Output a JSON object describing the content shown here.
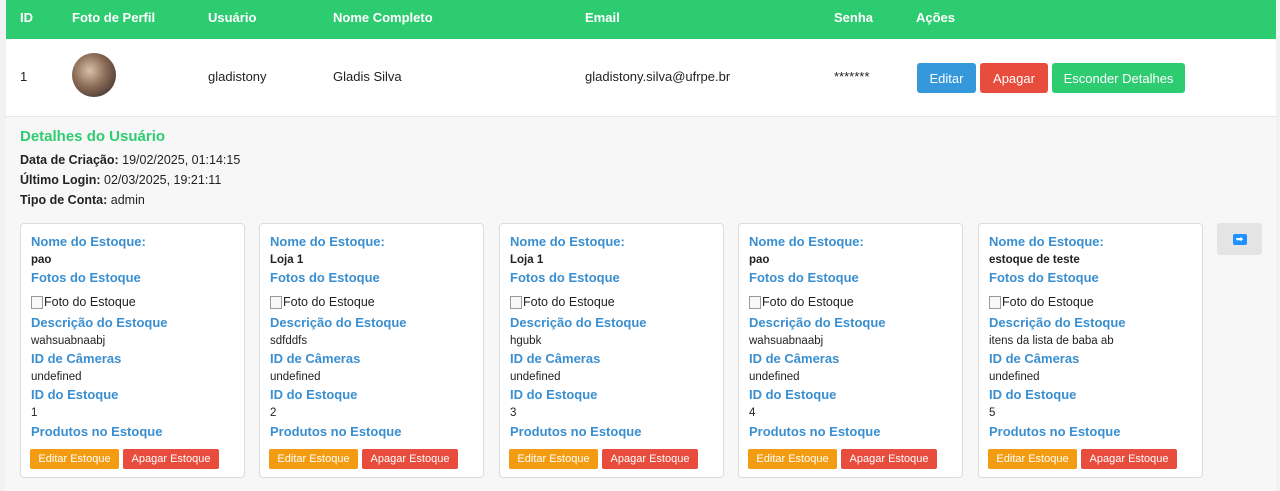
{
  "table": {
    "headers": [
      "ID",
      "Foto de Perfil",
      "Usuário",
      "Nome Completo",
      "Email",
      "Senha",
      "Ações"
    ],
    "row": {
      "id": "1",
      "username": "gladistony",
      "fullname": "Gladis Silva",
      "email": "gladistony.silva@ufrpe.br",
      "password": "*******",
      "edit_label": "Editar",
      "delete_label": "Apagar",
      "hide_label": "Esconder Detalhes"
    }
  },
  "details": {
    "title": "Detalhes do Usuário",
    "created_label": "Data de Criação:",
    "created_value": "19/02/2025, 01:14:15",
    "last_login_label": "Último Login:",
    "last_login_value": "02/03/2025, 19:21:11",
    "account_type_label": "Tipo de Conta:",
    "account_type_value": "admin"
  },
  "card_labels": {
    "name": "Nome do Estoque:",
    "photos": "Fotos do Estoque",
    "photo_alt": "Foto do Estoque",
    "description": "Descrição do Estoque",
    "camera_ids": "ID de Câmeras",
    "stock_id": "ID do Estoque",
    "products": "Produtos no Estoque",
    "edit_btn": "Editar Estoque",
    "delete_btn": "Apagar Estoque"
  },
  "stocks": [
    {
      "name": "pao",
      "description": "wahsuabnaabj",
      "cameras": "undefined",
      "id": "1"
    },
    {
      "name": "Loja 1",
      "description": "sdfddfs",
      "cameras": "undefined",
      "id": "2"
    },
    {
      "name": "Loja 1",
      "description": "hgubk",
      "cameras": "undefined",
      "id": "3"
    },
    {
      "name": "pao",
      "description": "wahsuabnaabj",
      "cameras": "undefined",
      "id": "4"
    },
    {
      "name": "estoque de teste",
      "description": "itens da lista de baba ab",
      "cameras": "undefined",
      "id": "5"
    }
  ],
  "icons": {
    "next": "arrow-right-icon",
    "avatar": "profile-photo"
  },
  "colors": {
    "header": "#2ecc71",
    "edit": "#3498db",
    "delete": "#e74c3c",
    "stock_edit": "#f39c12",
    "label_blue": "#3a8fd0"
  }
}
